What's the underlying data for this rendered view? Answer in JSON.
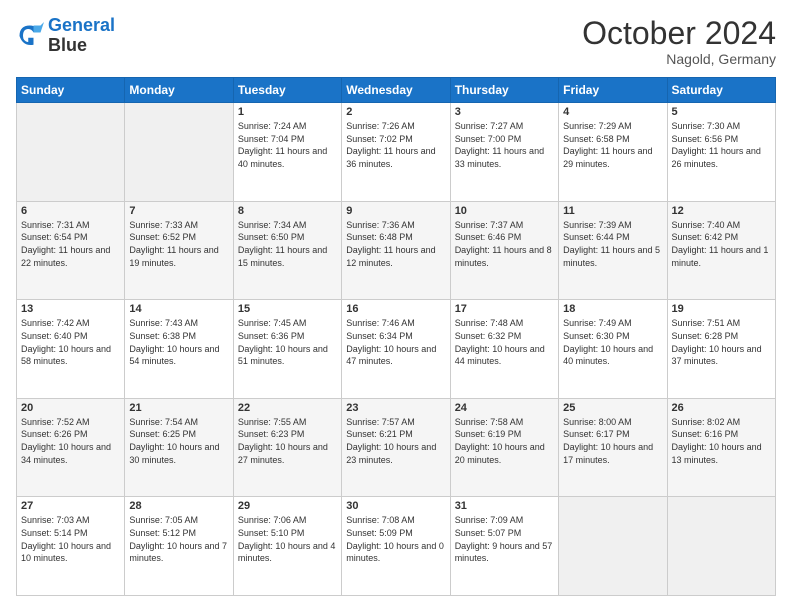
{
  "header": {
    "logo_line1": "General",
    "logo_line2": "Blue",
    "month_title": "October 2024",
    "location": "Nagold, Germany"
  },
  "weekdays": [
    "Sunday",
    "Monday",
    "Tuesday",
    "Wednesday",
    "Thursday",
    "Friday",
    "Saturday"
  ],
  "weeks": [
    [
      {
        "day": "",
        "info": ""
      },
      {
        "day": "",
        "info": ""
      },
      {
        "day": "1",
        "info": "Sunrise: 7:24 AM\nSunset: 7:04 PM\nDaylight: 11 hours and 40 minutes."
      },
      {
        "day": "2",
        "info": "Sunrise: 7:26 AM\nSunset: 7:02 PM\nDaylight: 11 hours and 36 minutes."
      },
      {
        "day": "3",
        "info": "Sunrise: 7:27 AM\nSunset: 7:00 PM\nDaylight: 11 hours and 33 minutes."
      },
      {
        "day": "4",
        "info": "Sunrise: 7:29 AM\nSunset: 6:58 PM\nDaylight: 11 hours and 29 minutes."
      },
      {
        "day": "5",
        "info": "Sunrise: 7:30 AM\nSunset: 6:56 PM\nDaylight: 11 hours and 26 minutes."
      }
    ],
    [
      {
        "day": "6",
        "info": "Sunrise: 7:31 AM\nSunset: 6:54 PM\nDaylight: 11 hours and 22 minutes."
      },
      {
        "day": "7",
        "info": "Sunrise: 7:33 AM\nSunset: 6:52 PM\nDaylight: 11 hours and 19 minutes."
      },
      {
        "day": "8",
        "info": "Sunrise: 7:34 AM\nSunset: 6:50 PM\nDaylight: 11 hours and 15 minutes."
      },
      {
        "day": "9",
        "info": "Sunrise: 7:36 AM\nSunset: 6:48 PM\nDaylight: 11 hours and 12 minutes."
      },
      {
        "day": "10",
        "info": "Sunrise: 7:37 AM\nSunset: 6:46 PM\nDaylight: 11 hours and 8 minutes."
      },
      {
        "day": "11",
        "info": "Sunrise: 7:39 AM\nSunset: 6:44 PM\nDaylight: 11 hours and 5 minutes."
      },
      {
        "day": "12",
        "info": "Sunrise: 7:40 AM\nSunset: 6:42 PM\nDaylight: 11 hours and 1 minute."
      }
    ],
    [
      {
        "day": "13",
        "info": "Sunrise: 7:42 AM\nSunset: 6:40 PM\nDaylight: 10 hours and 58 minutes."
      },
      {
        "day": "14",
        "info": "Sunrise: 7:43 AM\nSunset: 6:38 PM\nDaylight: 10 hours and 54 minutes."
      },
      {
        "day": "15",
        "info": "Sunrise: 7:45 AM\nSunset: 6:36 PM\nDaylight: 10 hours and 51 minutes."
      },
      {
        "day": "16",
        "info": "Sunrise: 7:46 AM\nSunset: 6:34 PM\nDaylight: 10 hours and 47 minutes."
      },
      {
        "day": "17",
        "info": "Sunrise: 7:48 AM\nSunset: 6:32 PM\nDaylight: 10 hours and 44 minutes."
      },
      {
        "day": "18",
        "info": "Sunrise: 7:49 AM\nSunset: 6:30 PM\nDaylight: 10 hours and 40 minutes."
      },
      {
        "day": "19",
        "info": "Sunrise: 7:51 AM\nSunset: 6:28 PM\nDaylight: 10 hours and 37 minutes."
      }
    ],
    [
      {
        "day": "20",
        "info": "Sunrise: 7:52 AM\nSunset: 6:26 PM\nDaylight: 10 hours and 34 minutes."
      },
      {
        "day": "21",
        "info": "Sunrise: 7:54 AM\nSunset: 6:25 PM\nDaylight: 10 hours and 30 minutes."
      },
      {
        "day": "22",
        "info": "Sunrise: 7:55 AM\nSunset: 6:23 PM\nDaylight: 10 hours and 27 minutes."
      },
      {
        "day": "23",
        "info": "Sunrise: 7:57 AM\nSunset: 6:21 PM\nDaylight: 10 hours and 23 minutes."
      },
      {
        "day": "24",
        "info": "Sunrise: 7:58 AM\nSunset: 6:19 PM\nDaylight: 10 hours and 20 minutes."
      },
      {
        "day": "25",
        "info": "Sunrise: 8:00 AM\nSunset: 6:17 PM\nDaylight: 10 hours and 17 minutes."
      },
      {
        "day": "26",
        "info": "Sunrise: 8:02 AM\nSunset: 6:16 PM\nDaylight: 10 hours and 13 minutes."
      }
    ],
    [
      {
        "day": "27",
        "info": "Sunrise: 7:03 AM\nSunset: 5:14 PM\nDaylight: 10 hours and 10 minutes."
      },
      {
        "day": "28",
        "info": "Sunrise: 7:05 AM\nSunset: 5:12 PM\nDaylight: 10 hours and 7 minutes."
      },
      {
        "day": "29",
        "info": "Sunrise: 7:06 AM\nSunset: 5:10 PM\nDaylight: 10 hours and 4 minutes."
      },
      {
        "day": "30",
        "info": "Sunrise: 7:08 AM\nSunset: 5:09 PM\nDaylight: 10 hours and 0 minutes."
      },
      {
        "day": "31",
        "info": "Sunrise: 7:09 AM\nSunset: 5:07 PM\nDaylight: 9 hours and 57 minutes."
      },
      {
        "day": "",
        "info": ""
      },
      {
        "day": "",
        "info": ""
      }
    ]
  ]
}
